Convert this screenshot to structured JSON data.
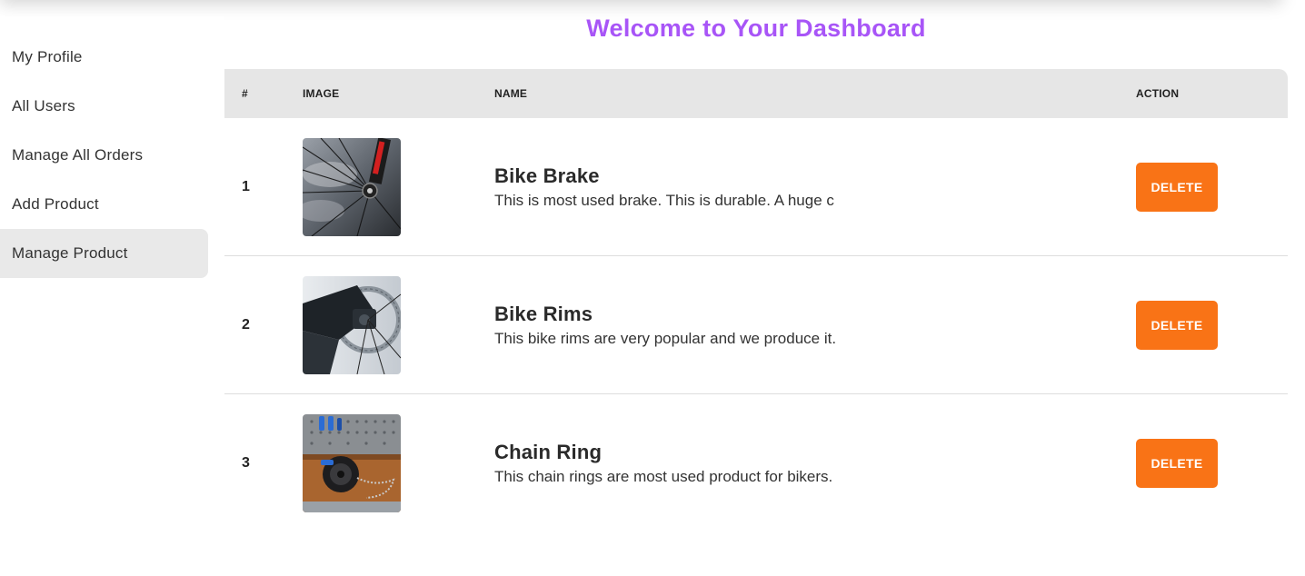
{
  "sidebar": {
    "items": [
      {
        "label": "My Profile"
      },
      {
        "label": "All Users"
      },
      {
        "label": "Manage All Orders"
      },
      {
        "label": "Add Product"
      },
      {
        "label": "Manage Product"
      }
    ],
    "active_index": 4
  },
  "main": {
    "title": "Welcome to Your Dashboard",
    "table": {
      "headers": {
        "num": "#",
        "image": "IMAGE",
        "name": "NAME",
        "action": "ACTION"
      },
      "rows": [
        {
          "num": "1",
          "image_icon": "bike-brake-photo",
          "name": "Bike Brake",
          "description": "This is most used brake. This is durable. A huge c",
          "action_label": "DELETE"
        },
        {
          "num": "2",
          "image_icon": "bike-rims-photo",
          "name": "Bike Rims",
          "description": "This bike rims are very popular and we produce it.",
          "action_label": "DELETE"
        },
        {
          "num": "3",
          "image_icon": "chain-ring-photo",
          "name": "Chain Ring",
          "description": "This chain rings are most used product for bikers.",
          "action_label": "DELETE"
        }
      ]
    }
  },
  "colors": {
    "title": "#a855f7",
    "delete_button": "#f97316",
    "header_bg": "#e6e6e6",
    "active_sidebar_bg": "#e9e9e9"
  }
}
